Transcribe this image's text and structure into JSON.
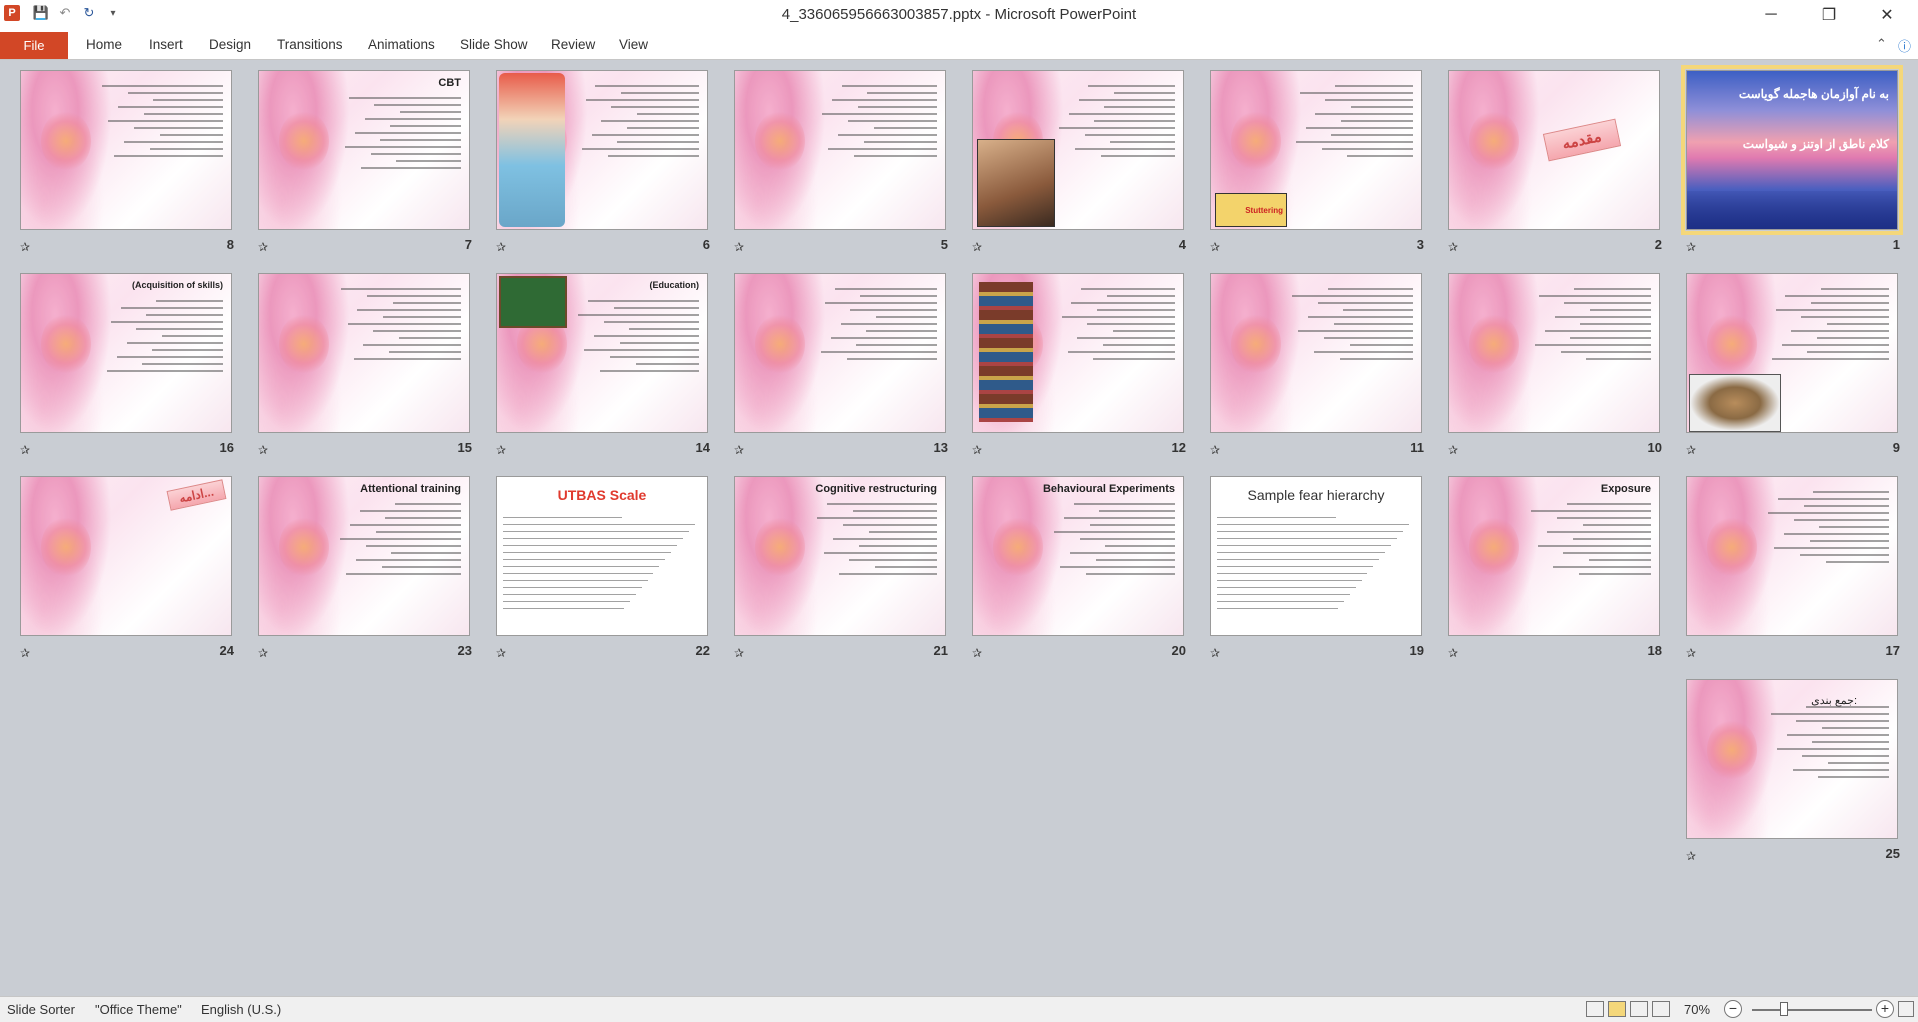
{
  "window": {
    "title": "4_336065956663003857.pptx - Microsoft PowerPoint",
    "app_icon": "P",
    "minimize": "─",
    "restore": "❐",
    "close": "✕"
  },
  "ribbon": {
    "tabs": [
      "File",
      "Home",
      "Insert",
      "Design",
      "Transitions",
      "Animations",
      "Slide Show",
      "Review",
      "View"
    ]
  },
  "slides": [
    {
      "num": "1",
      "title": "به نام آوازمان هاجمله گویاست",
      "subtitle": "کلام ناطق از اوتنز و شیواست",
      "kind": "sunset"
    },
    {
      "num": "2",
      "title": "مقدمه",
      "kind": "banner"
    },
    {
      "num": "3",
      "label": "Stuttering",
      "kind": "text"
    },
    {
      "num": "4",
      "kind": "face"
    },
    {
      "num": "5",
      "kind": "text"
    },
    {
      "num": "6",
      "kind": "cartoon"
    },
    {
      "num": "7",
      "title": "CBT",
      "kind": "text"
    },
    {
      "num": "8",
      "kind": "text"
    },
    {
      "num": "9",
      "kind": "meeting"
    },
    {
      "num": "10",
      "kind": "text"
    },
    {
      "num": "11",
      "kind": "text"
    },
    {
      "num": "12",
      "kind": "books"
    },
    {
      "num": "13",
      "kind": "text"
    },
    {
      "num": "14",
      "title": "(Education)",
      "kind": "board"
    },
    {
      "num": "15",
      "kind": "text"
    },
    {
      "num": "16",
      "title": "(Acquisition of skills)",
      "kind": "text"
    },
    {
      "num": "17",
      "kind": "text"
    },
    {
      "num": "18",
      "title": "Exposure",
      "kind": "text"
    },
    {
      "num": "19",
      "title": "Sample fear hierarchy",
      "kind": "doc"
    },
    {
      "num": "20",
      "title": "Behavioural Experiments",
      "kind": "text"
    },
    {
      "num": "21",
      "title": "Cognitive restructuring",
      "kind": "text"
    },
    {
      "num": "22",
      "title": "UTBAS Scale",
      "kind": "doc"
    },
    {
      "num": "23",
      "title": "Attentional training",
      "kind": "text"
    },
    {
      "num": "24",
      "title": "ادامه...",
      "kind": "banner"
    },
    {
      "num": "25",
      "title": "جمع بندی:",
      "kind": "text"
    }
  ],
  "status": {
    "view": "Slide Sorter",
    "theme": "\"Office Theme\"",
    "language": "English (U.S.)",
    "zoom": "70%",
    "zoom_minus": "−",
    "zoom_plus": "+"
  }
}
